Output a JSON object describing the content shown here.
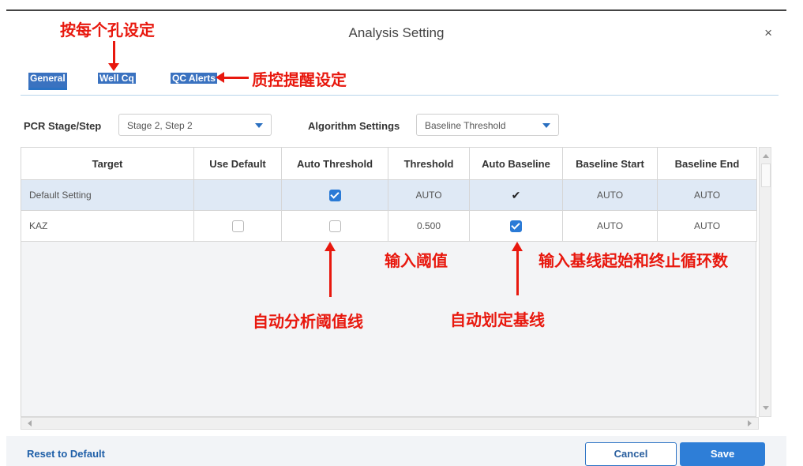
{
  "dialog": {
    "title": "Analysis Setting",
    "close_glyph": "×"
  },
  "tabs": [
    {
      "label": "General"
    },
    {
      "label": "Well Cq"
    },
    {
      "label": "QC Alerts"
    }
  ],
  "filters": {
    "pcr_label": "PCR Stage/Step",
    "pcr_value": "Stage 2, Step 2",
    "algo_label": "Algorithm Settings",
    "algo_value": "Baseline Threshold"
  },
  "table": {
    "headers": [
      "Target",
      "Use Default",
      "Auto Threshold",
      "Threshold",
      "Auto Baseline",
      "Baseline Start",
      "Baseline End"
    ],
    "rows": [
      {
        "target": "Default Setting",
        "use_default": "",
        "auto_threshold": true,
        "threshold": "AUTO",
        "auto_baseline": "✔",
        "baseline_start": "AUTO",
        "baseline_end": "AUTO",
        "selected": true
      },
      {
        "target": "KAZ",
        "use_default": false,
        "auto_threshold": false,
        "threshold": "0.500",
        "auto_baseline": true,
        "baseline_start": "AUTO",
        "baseline_end": "AUTO",
        "selected": false
      }
    ]
  },
  "footer": {
    "reset_label": "Reset to Default",
    "cancel_label": "Cancel",
    "save_label": "Save"
  },
  "annotations": {
    "per_well": "按每个孔设定",
    "qc_alert": "质控提醒设定",
    "input_threshold": "输入阈值",
    "input_baseline": "输入基线起始和终止循环数",
    "auto_threshold_line": "自动分析阈值线",
    "auto_baseline": "自动划定基线"
  },
  "colors": {
    "accent": "#2a72c4",
    "annotation": "#e8180e",
    "selected_row": "#dfe9f5"
  }
}
